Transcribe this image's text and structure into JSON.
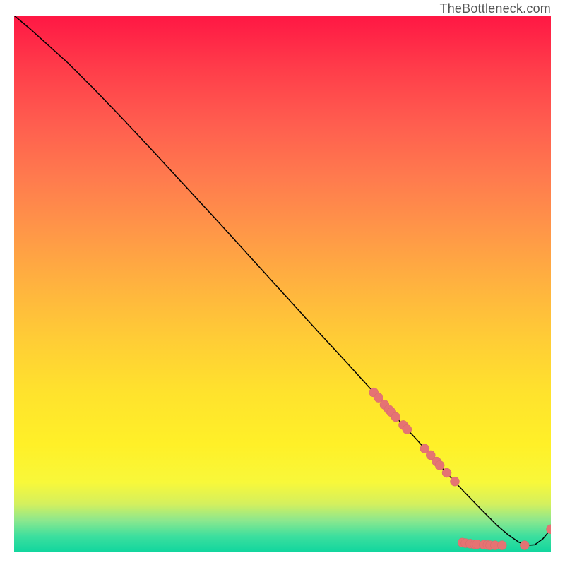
{
  "watermark": "TheBottleneck.com",
  "colors": {
    "dot_fill": "#e57373",
    "dot_stroke": "#d46a6a",
    "curve": "#000000"
  },
  "chart_data": {
    "type": "line",
    "title": "",
    "xlabel": "",
    "ylabel": "",
    "xlim": [
      0,
      100
    ],
    "ylim": [
      0,
      100
    ],
    "grid": false,
    "legend": false,
    "series": [
      {
        "name": "curve",
        "x": [
          0,
          3,
          6,
          10,
          15,
          20,
          26,
          32,
          38,
          44,
          50,
          56,
          62,
          67,
          71,
          75,
          78,
          81,
          84,
          87,
          90,
          92,
          94,
          95.5,
          97,
          98.5,
          100
        ],
        "y": [
          100,
          97.5,
          94.8,
          91.2,
          86.2,
          81.0,
          74.6,
          68.1,
          61.6,
          55.0,
          48.4,
          41.8,
          35.3,
          29.8,
          25.3,
          21.0,
          17.6,
          14.3,
          11.1,
          8.0,
          5.0,
          3.3,
          1.9,
          1.3,
          1.4,
          2.5,
          4.3
        ]
      }
    ],
    "points": [
      {
        "x": 67.0,
        "y": 29.8
      },
      {
        "x": 67.9,
        "y": 28.8
      },
      {
        "x": 69.0,
        "y": 27.5
      },
      {
        "x": 69.8,
        "y": 26.6
      },
      {
        "x": 70.3,
        "y": 26.1
      },
      {
        "x": 71.1,
        "y": 25.2
      },
      {
        "x": 72.5,
        "y": 23.7
      },
      {
        "x": 73.2,
        "y": 22.9
      },
      {
        "x": 76.5,
        "y": 19.3
      },
      {
        "x": 77.6,
        "y": 18.1
      },
      {
        "x": 78.7,
        "y": 16.9
      },
      {
        "x": 79.3,
        "y": 16.2
      },
      {
        "x": 80.6,
        "y": 14.8
      },
      {
        "x": 82.1,
        "y": 13.2
      },
      {
        "x": 83.5,
        "y": 1.8
      },
      {
        "x": 84.1,
        "y": 1.7
      },
      {
        "x": 85.0,
        "y": 1.6
      },
      {
        "x": 85.8,
        "y": 1.5
      },
      {
        "x": 86.2,
        "y": 1.5
      },
      {
        "x": 87.5,
        "y": 1.4
      },
      {
        "x": 88.2,
        "y": 1.35
      },
      {
        "x": 88.7,
        "y": 1.3
      },
      {
        "x": 89.6,
        "y": 1.3
      },
      {
        "x": 90.9,
        "y": 1.3
      },
      {
        "x": 95.1,
        "y": 1.3
      },
      {
        "x": 100.0,
        "y": 4.3
      }
    ]
  }
}
